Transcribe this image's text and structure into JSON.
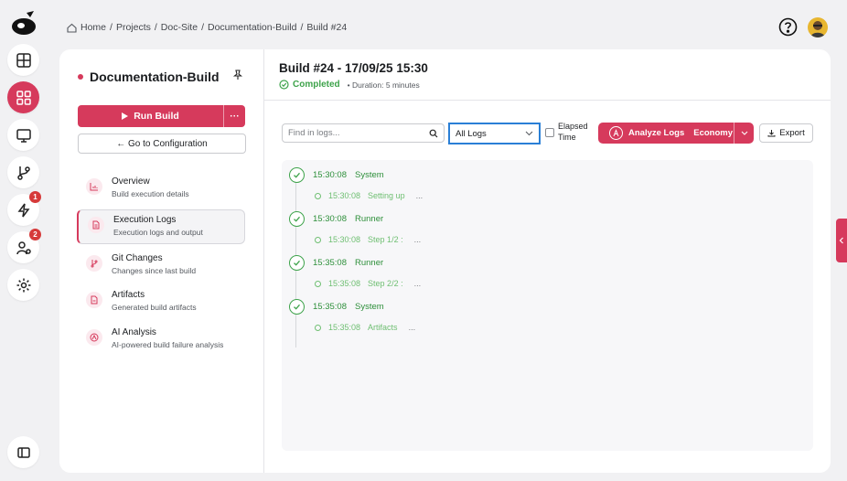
{
  "breadcrumb": [
    "Home",
    "Projects",
    "Doc-Site",
    "Documentation-Build",
    "Build #24"
  ],
  "rail": {
    "badges": {
      "notifications": "1",
      "users": "2"
    }
  },
  "project": {
    "name": "Documentation-Build",
    "run_label": "Run Build",
    "more_label": "···",
    "goto_label": "← Go to Configuration"
  },
  "nav": [
    {
      "title": "Overview",
      "subtitle": "Build execution details"
    },
    {
      "title": "Execution Logs",
      "subtitle": "Execution logs and output"
    },
    {
      "title": "Git Changes",
      "subtitle": "Changes since last build"
    },
    {
      "title": "Artifacts",
      "subtitle": "Generated build artifacts"
    },
    {
      "title": "AI Analysis",
      "subtitle": "AI-powered build failure analysis"
    }
  ],
  "build": {
    "title": "Build #24 - 17/09/25 15:30",
    "status": "Completed",
    "duration": "• Duration: 5 minutes"
  },
  "toolbar": {
    "search_placeholder": "Find in logs...",
    "filter_value": "All Logs",
    "elapsed_label_1": "Elapsed",
    "elapsed_label_2": "Time",
    "analyze_label": "Analyze Logs",
    "analyze_mode": "Economy",
    "export_label": "Export"
  },
  "logs": [
    {
      "time": "15:30:08",
      "source": "System",
      "sub_time": "15:30:08",
      "sub_text": "Setting up",
      "sub_more": "..."
    },
    {
      "time": "15:30:08",
      "source": "Runner",
      "sub_time": "15:30:08",
      "sub_text": "Step 1/2 :",
      "sub_more": "..."
    },
    {
      "time": "15:35:08",
      "source": "Runner",
      "sub_time": "15:35:08",
      "sub_text": "Step 2/2 :",
      "sub_more": "..."
    },
    {
      "time": "15:35:08",
      "source": "System",
      "sub_time": "15:35:08",
      "sub_text": "Artifacts",
      "sub_more": "..."
    }
  ],
  "colors": {
    "accent": "#d63a5c",
    "success": "#3ea34b",
    "focus": "#2a7fd6"
  }
}
